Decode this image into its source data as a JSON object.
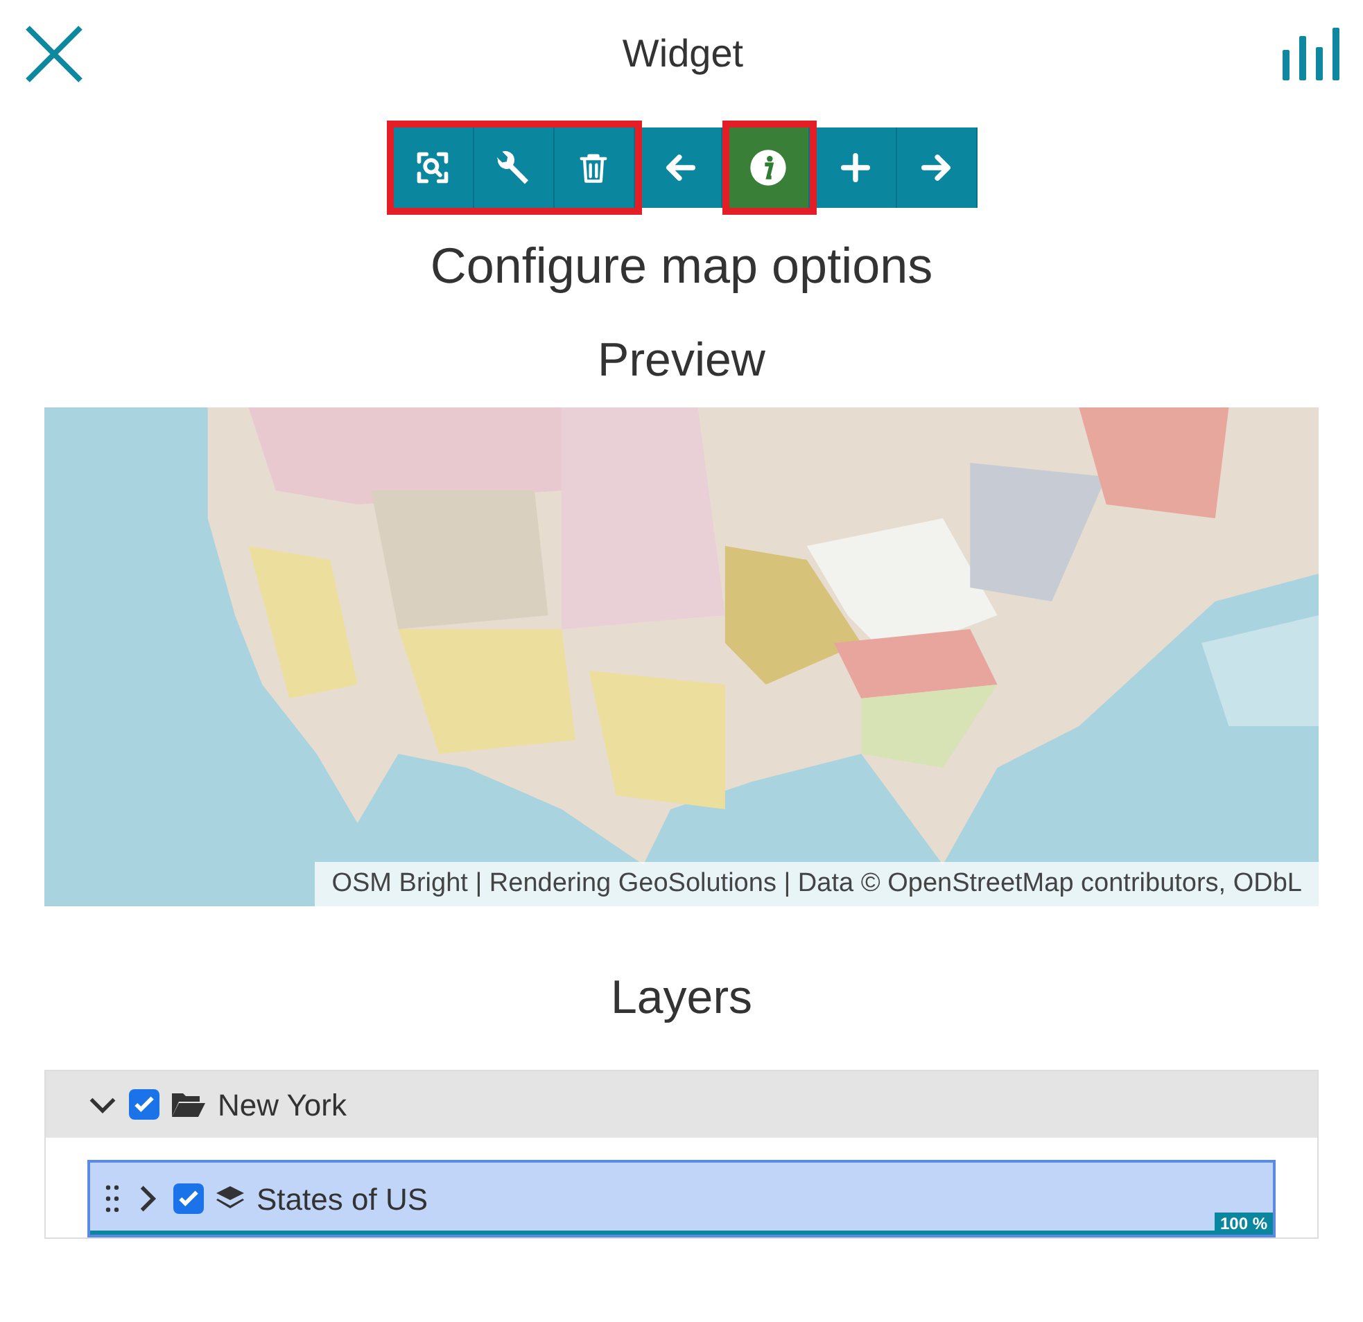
{
  "header": {
    "title": "Widget"
  },
  "toolbar": [
    {
      "highlighted": true,
      "buttons": [
        {
          "kind": "zoom",
          "active": false
        },
        {
          "kind": "wrench",
          "active": false
        },
        {
          "kind": "trash",
          "active": false
        }
      ]
    },
    {
      "highlighted": false,
      "buttons": [
        {
          "kind": "back",
          "active": false
        }
      ]
    },
    {
      "highlighted": true,
      "buttons": [
        {
          "kind": "info",
          "active": true
        }
      ]
    },
    {
      "highlighted": false,
      "buttons": [
        {
          "kind": "plus",
          "active": false
        },
        {
          "kind": "next",
          "active": false
        }
      ]
    }
  ],
  "heading": "Configure map options",
  "preview": {
    "title": "Preview",
    "map": {
      "kind": "picture",
      "attribution": "OSM Bright | Rendering GeoSolutions | Data © OpenStreetMap contributors, ODbL"
    }
  },
  "layers": {
    "title": "Layers",
    "group": {
      "name": "New York",
      "expanded": true,
      "checked": true,
      "children": [
        {
          "name": "States of US",
          "expanded": false,
          "checked": true,
          "selected": true,
          "level": 1,
          "reading": "100 %"
        }
      ]
    }
  }
}
